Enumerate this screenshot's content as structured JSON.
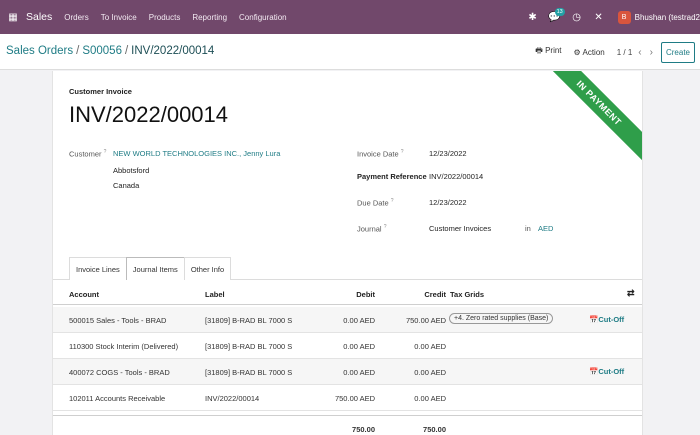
{
  "navbar": {
    "app_name": "Sales",
    "menu": [
      "Orders",
      "To Invoice",
      "Products",
      "Reporting",
      "Configuration"
    ],
    "chat_count": "13",
    "avatar_letter": "B",
    "user": "Bhushan (testrad2",
    "colors": {
      "bar": "#71486b"
    }
  },
  "control": {
    "breadcrumb": [
      "Sales Orders",
      "S00056",
      "INV/2022/00014"
    ],
    "print": "Print",
    "action": "Action",
    "pager": "1 / 1",
    "create": "Create"
  },
  "invoice": {
    "ribbon": "IN PAYMENT",
    "type": "Customer Invoice",
    "name": "INV/2022/00014",
    "customer_label": "Customer",
    "customer": "NEW WORLD TECHNOLOGIES INC., Jenny Lura",
    "address_line1": "Abbotsford",
    "address_line2": "Canada",
    "invoice_date_label": "Invoice Date",
    "invoice_date": "12/23/2022",
    "payment_ref_label": "Payment Reference",
    "payment_ref": "INV/2022/00014",
    "due_date_label": "Due Date",
    "due_date": "12/23/2022",
    "journal_label": "Journal",
    "journal": "Customer Invoices",
    "journal_in": "in",
    "currency": "AED"
  },
  "tabs": [
    "Invoice Lines",
    "Journal Items",
    "Other Info"
  ],
  "table": {
    "headers": {
      "account": "Account",
      "label": "Label",
      "debit": "Debit",
      "credit": "Credit",
      "tax_grids": "Tax Grids"
    },
    "rows": [
      {
        "account": "500015 Sales - Tools - BRAD",
        "label": "[31809] B-RAD BL 7000 S",
        "debit": "0.00 AED",
        "credit": "750.00 AED",
        "tax": "+4. Zero rated supplies (Base)",
        "cutoff": "Cut-Off"
      },
      {
        "account": "110300 Stock Interim (Delivered)",
        "label": "[31809] B-RAD BL 7000 S",
        "debit": "0.00 AED",
        "credit": "0.00 AED",
        "tax": "",
        "cutoff": ""
      },
      {
        "account": "400072 COGS - Tools - BRAD",
        "label": "[31809] B-RAD BL 7000 S",
        "debit": "0.00 AED",
        "credit": "0.00 AED",
        "tax": "",
        "cutoff": "Cut-Off"
      },
      {
        "account": "102011 Accounts Receivable",
        "label": "INV/2022/00014",
        "debit": "750.00 AED",
        "credit": "0.00 AED",
        "tax": "",
        "cutoff": ""
      }
    ],
    "totals": {
      "debit": "750.00",
      "credit": "750.00"
    }
  }
}
